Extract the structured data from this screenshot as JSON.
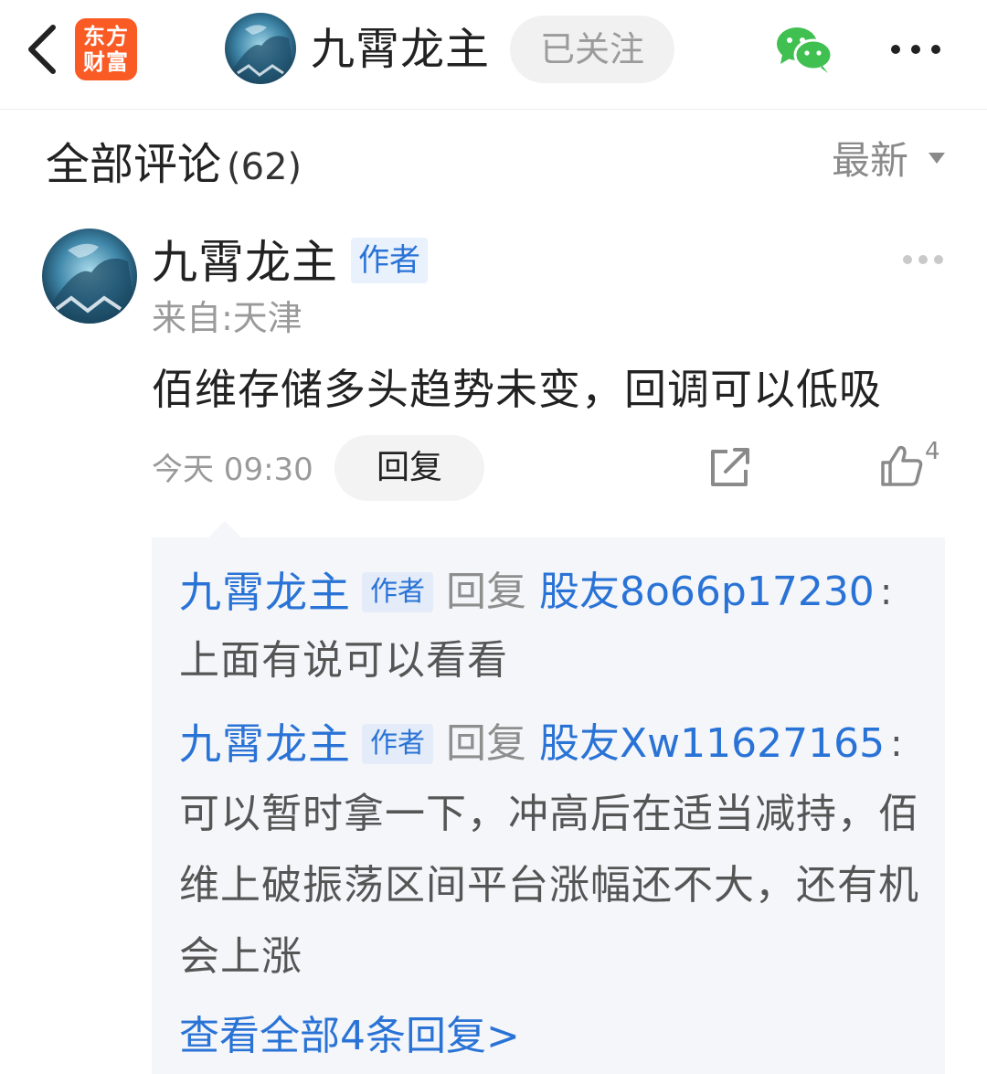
{
  "header": {
    "logo_line1": "东方",
    "logo_line2": "财富",
    "user_name": "九霄龙主",
    "follow_label": "已关注"
  },
  "comments_section": {
    "title": "全部评论",
    "count": "(62)",
    "sort_label": "最新"
  },
  "comment": {
    "author": "九霄龙主",
    "author_tag": "作者",
    "location": "来自:天津",
    "content": "佰维存储多头趋势未变，回调可以低吸",
    "time": "今天 09:30",
    "reply_label": "回复",
    "like_count": "4"
  },
  "replies": [
    {
      "name": "九霄龙主",
      "tag": "作者",
      "verb": "回复",
      "target": "股友8o66p17230",
      "colon": ":",
      "text": "上面有说可以看看"
    },
    {
      "name": "九霄龙主",
      "tag": "作者",
      "verb": "回复",
      "target": "股友Xw11627165",
      "colon": ":",
      "text": "可以暂时拿一下，冲高后在适当减持，佰维上破振荡区间平台涨幅还不大，还有机会上涨"
    }
  ],
  "view_all_label": "查看全部4条回复>",
  "colors": {
    "accent_blue": "#2a73d6",
    "logo_orange": "#fa5a24",
    "wechat_green": "#3fc050"
  },
  "icons": [
    "back-arrow-icon",
    "wechat-icon",
    "more-dots-icon",
    "share-icon",
    "thumbs-up-icon",
    "caret-down-icon"
  ]
}
